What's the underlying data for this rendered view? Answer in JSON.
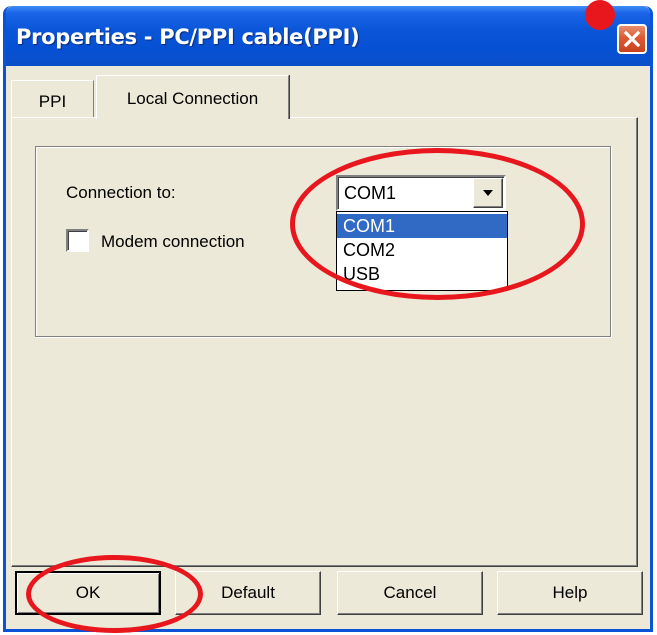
{
  "window": {
    "title": "Properties - PC/PPI cable(PPI)",
    "title_bar_color": "#0a55d8",
    "close_icon": "close-icon"
  },
  "tabs": [
    {
      "label": "PPI",
      "active": false
    },
    {
      "label": "Local Connection",
      "active": true
    }
  ],
  "local_connection": {
    "connection_to_label": "Connection to:",
    "connection_select": {
      "value": "COM1",
      "options": [
        "COM1",
        "COM2",
        "USB"
      ],
      "highlighted": "COM1",
      "expanded": true,
      "arrow_icon": "chevron-down-icon"
    },
    "modem_checkbox": {
      "label": "Modem connection",
      "checked": false
    }
  },
  "buttons": {
    "ok": "OK",
    "default": "Default",
    "cancel": "Cancel",
    "help": "Help"
  },
  "annotations": {
    "color": "#e8171d"
  }
}
